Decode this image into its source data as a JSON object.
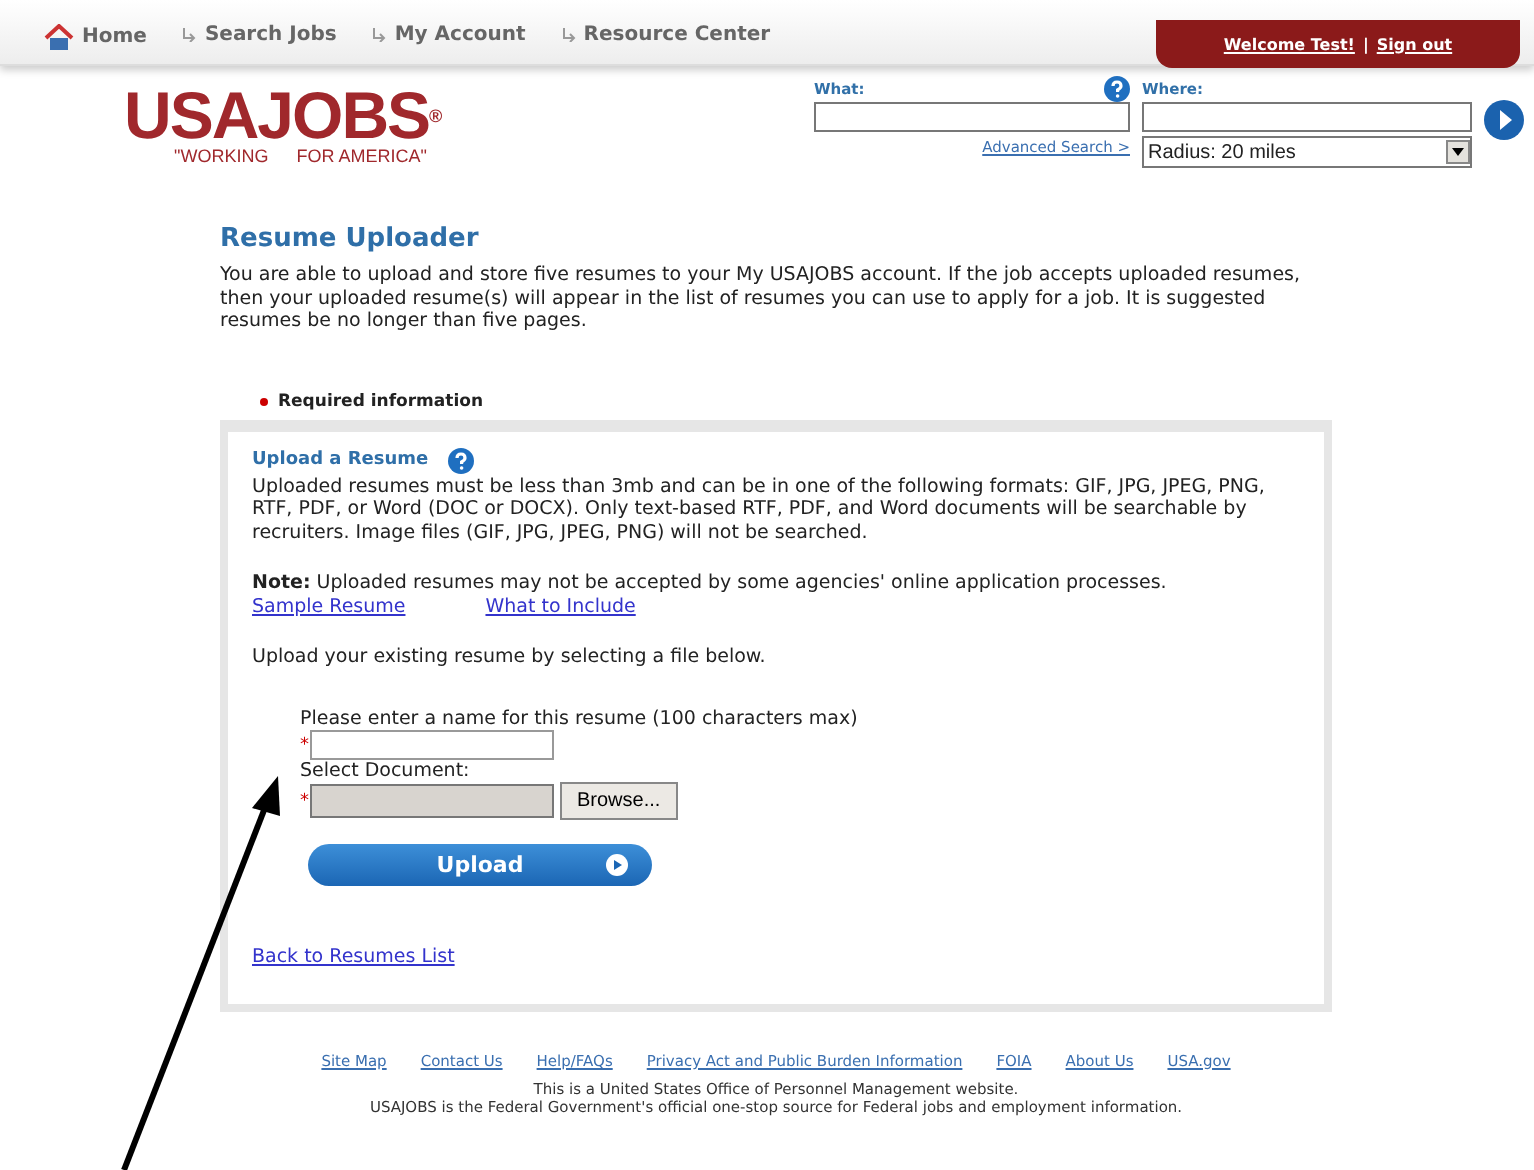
{
  "nav": {
    "items": [
      {
        "label": "Home",
        "kind": "home"
      },
      {
        "label": "Search Jobs",
        "kind": "link"
      },
      {
        "label": "My Account",
        "kind": "link"
      },
      {
        "label": "Resource Center",
        "kind": "link"
      }
    ],
    "welcome": "Welcome Test!",
    "separator": "|",
    "signout": "Sign out"
  },
  "logo": {
    "name": "USAJOBS",
    "mark": "®",
    "tagline_left": "\"WORKING",
    "tagline_right": "FOR AMERICA\""
  },
  "search": {
    "what_label": "What:",
    "where_label": "Where:",
    "advanced": "Advanced Search >",
    "radius": "Radius: 20 miles"
  },
  "title": "Resume Uploader",
  "intro": "You are able to upload and store five resumes to your My USAJOBS account. If the job accepts uploaded resumes, then your uploaded resume(s) will appear in the list of resumes you can use to apply for a job. It is suggested resumes be no longer than five pages.",
  "required": "Required information",
  "panel": {
    "heading": "Upload a Resume",
    "formats": "Uploaded resumes must be less than 3mb and can be in one of the following formats: GIF, JPG, JPEG, PNG, RTF, PDF, or Word (DOC or DOCX). Only text-based RTF, PDF, and Word documents will be searchable by recruiters. Image files (GIF, JPG, JPEG, PNG) will not be searched.",
    "note": "**Note:** Uploaded resumes may not be accepted by some agencies' online application processes.",
    "links": [
      "Sample Resume",
      "What to Include"
    ],
    "instruction": "Upload your existing resume by selecting a file below.",
    "name_label": "Please enter a name for this resume (100 characters max)",
    "doc_label": "Select Document:",
    "required_mark": "*",
    "browse": "Browse...",
    "upload": "Upload",
    "back": "Back to Resumes List"
  },
  "footer": {
    "links": [
      "Site Map",
      "Contact Us",
      "Help/FAQs",
      "Privacy Act and Public Burden Information",
      "FOIA",
      "About Us",
      "USA.gov"
    ],
    "lines": [
      "This is a United States Office of Personnel Management website.",
      "USAJOBS is the Federal Government's official one-stop source for Federal jobs and employment information."
    ]
  }
}
